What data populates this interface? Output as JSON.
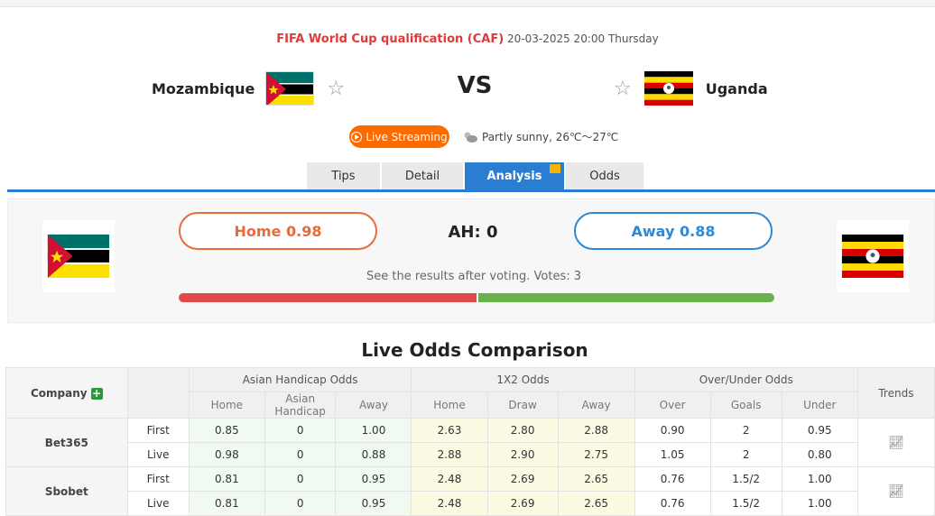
{
  "match": {
    "league": "FIFA World Cup qualification (CAF)",
    "datetime": "20-03-2025 20:00 Thursday",
    "home_team": "Mozambique",
    "away_team": "Uganda",
    "vs": "VS",
    "live_streaming": "Live Streaming",
    "weather": "Partly sunny, 26℃～27℃"
  },
  "tabs": [
    {
      "label": "Tips"
    },
    {
      "label": "Detail"
    },
    {
      "label": "Analysis"
    },
    {
      "label": "Odds"
    }
  ],
  "vote": {
    "home_label": "Home 0.98",
    "away_label": "Away 0.88",
    "ah_label": "AH: 0",
    "results_text": "See the results after voting. Votes: 3",
    "home_fraction": 0.5
  },
  "odds": {
    "title": "Live Odds Comparison",
    "headers": {
      "company": "Company",
      "asian": "Asian Handicap Odds",
      "x12": "1X2 Odds",
      "ou": "Over/Under Odds",
      "trends": "Trends"
    },
    "subheaders": {
      "asian": [
        "Home",
        "Asian Handicap",
        "Away"
      ],
      "x12": [
        "Home",
        "Draw",
        "Away"
      ],
      "ou": [
        "Over",
        "Goals",
        "Under"
      ]
    },
    "rows": [
      {
        "company": "Bet365",
        "first": {
          "label": "First",
          "ah": [
            "0.85",
            "0",
            "1.00"
          ],
          "x12": [
            "2.63",
            "2.80",
            "2.88"
          ],
          "ou": [
            "0.90",
            "2",
            "0.95"
          ]
        },
        "live": {
          "label": "Live",
          "ah": [
            "0.98",
            "0",
            "0.88"
          ],
          "x12": [
            "2.88",
            "2.90",
            "2.75"
          ],
          "ou": [
            "1.05",
            "2",
            "0.80"
          ]
        }
      },
      {
        "company": "Sbobet",
        "first": {
          "label": "First",
          "ah": [
            "0.81",
            "0",
            "0.95"
          ],
          "x12": [
            "2.48",
            "2.69",
            "2.65"
          ],
          "ou": [
            "0.76",
            "1.5/2",
            "1.00"
          ]
        },
        "live": {
          "label": "Live",
          "ah": [
            "0.81",
            "0",
            "0.95"
          ],
          "x12": [
            "2.48",
            "2.69",
            "2.65"
          ],
          "ou": [
            "0.76",
            "1.5/2",
            "1.00"
          ]
        }
      }
    ]
  },
  "colors": {
    "accent_blue": "#2a7dd1",
    "home_orange": "#e86b3c",
    "away_blue": "#2a8ad8",
    "live_orange": "#ff6a00",
    "league_red": "#e03a3a"
  },
  "icons": {
    "star": "star-icon",
    "play": "play-icon",
    "weather": "cloud-sun-icon",
    "trend": "trend-chart-icon",
    "plus": "plus-icon"
  }
}
